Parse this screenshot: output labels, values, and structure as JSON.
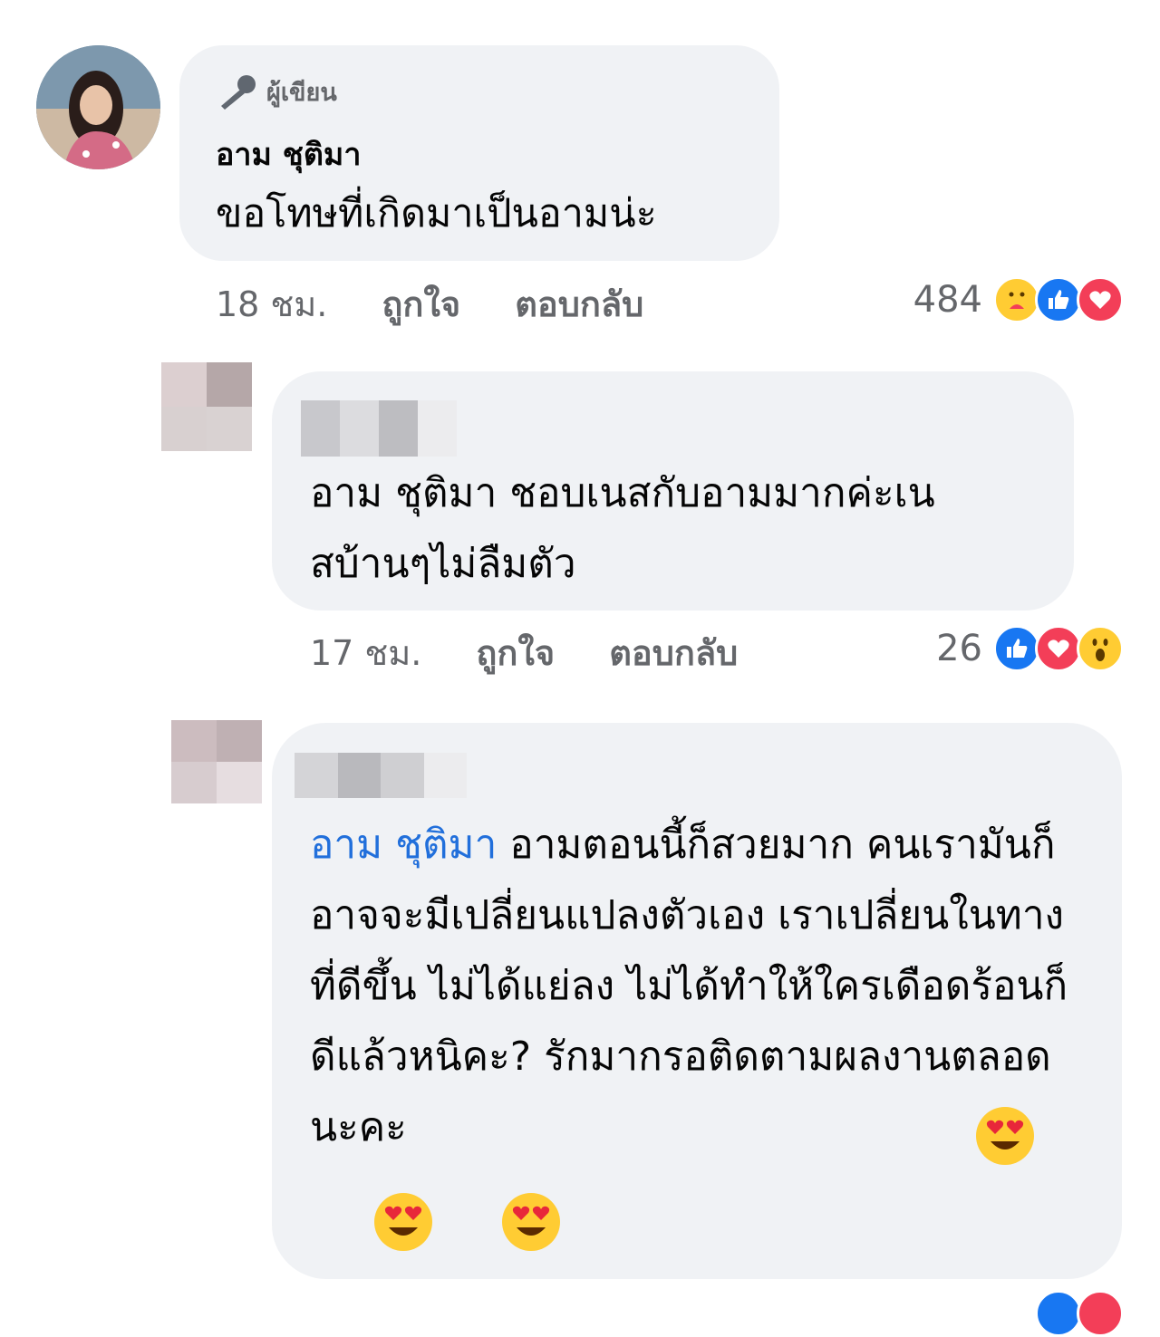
{
  "comment1": {
    "author_badge": "ผู้เขียน",
    "author_name": "อาม ชุติมา",
    "text": "ขอโทษที่เกิดมาเป็นอามน่ะ",
    "time": "18 ชม.",
    "like_label": "ถูกใจ",
    "reply_label": "ตอบกลับ",
    "reaction_count": "484",
    "reactions": [
      "care-icon",
      "like-icon",
      "love-icon"
    ]
  },
  "reply1": {
    "text": "อาม ชุติมา ชอบเนสกับอามมากค่ะเนสบ้านๆไม่ลืมตัว",
    "time": "17 ชม.",
    "like_label": "ถูกใจ",
    "reply_label": "ตอบกลับ",
    "reaction_count": "26",
    "reactions": [
      "like-icon",
      "love-icon",
      "wow-icon"
    ]
  },
  "reply2": {
    "mention": "อาม ชุติมา",
    "text": " อามตอนนี้ก็สวยมาก คนเรามันก็อาจจะมีเปลี่ยนแปลงตัวเอง เราเปลี่ยนในทางที่ดีขึ้น ไม่ได้แย่ลง ไม่ได้ทำให้ใครเดือดร้อนก็ดีแล้วหนิคะ? รักมากรอติดตามผลงานตลอดนะคะ",
    "emojis": [
      "heart-eyes-emoji",
      "heart-eyes-emoji",
      "heart-eyes-emoji"
    ]
  },
  "colors": {
    "bubble": "#f0f2f5",
    "mention": "#216fdb",
    "meta_text": "#65676b",
    "like_blue": "#1877f2",
    "love_red": "#f33e58"
  }
}
